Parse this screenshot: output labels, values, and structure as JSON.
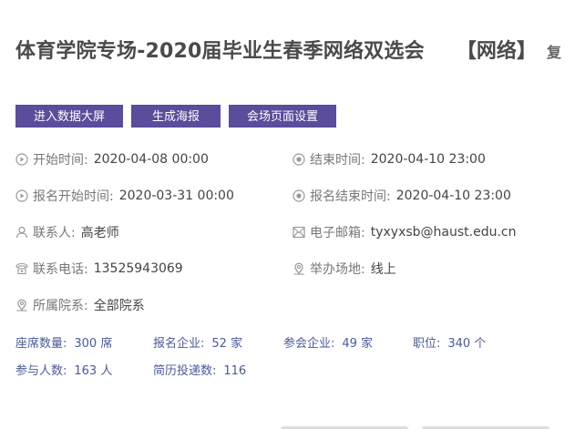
{
  "header": {
    "title": "体育学院专场-2020届毕业生春季网络双选会",
    "tag": "【网络】",
    "cut_text": "复"
  },
  "buttons": {
    "big_screen": "进入数据大屏",
    "poster": "生成海报",
    "page_settings": "会场页面设置"
  },
  "info": {
    "start_label": "开始时间:",
    "start_value": "2020-04-08 00:00",
    "end_label": "结束时间:",
    "end_value": "2020-04-10 23:00",
    "signup_start_label": "报名开始时间:",
    "signup_start_value": "2020-03-31 00:00",
    "signup_end_label": "报名结束时间:",
    "signup_end_value": "2020-04-10 23:00",
    "contact_label": "联系人:",
    "contact_value": "高老师",
    "email_label": "电子邮箱:",
    "email_value": "tyxyxsb@haust.edu.cn",
    "phone_label": "联系电话:",
    "phone_value": "13525943069",
    "venue_label": "举办场地:",
    "venue_value": "线上",
    "dept_label": "所属院系:",
    "dept_value": "全部院系"
  },
  "stats": {
    "seats_label": "座席数量:",
    "seats_value": "300 席",
    "signup_companies_label": "报名企业:",
    "signup_companies_value": "52 家",
    "attend_companies_label": "参会企业:",
    "attend_companies_value": "49 家",
    "positions_label": "职位:",
    "positions_value": "340 个",
    "participants_label": "参与人数:",
    "participants_value": "163 人",
    "resumes_label": "简历投递数:",
    "resumes_value": "116"
  },
  "colors": {
    "accent": "#5b4c9c",
    "stats_text": "#4a5a9c"
  }
}
